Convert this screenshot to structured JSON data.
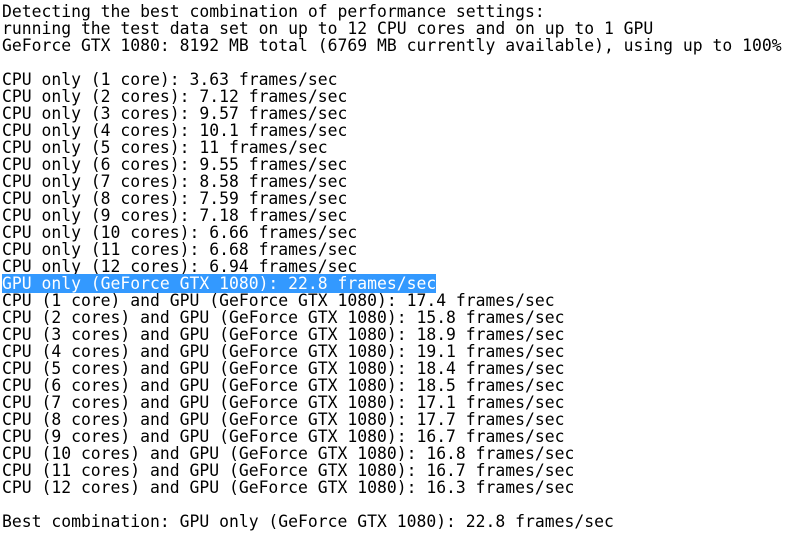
{
  "console": {
    "selection_color": "#3399ff",
    "lines": [
      {
        "text": "Detecting the best combination of performance settings:"
      },
      {
        "text": "running the test data set on up to 12 CPU cores and on up to 1 GPU"
      },
      {
        "text": "GeForce GTX 1080: 8192 MB total (6769 MB currently available), using up to 100%"
      },
      {
        "text": ""
      },
      {
        "text": "CPU only (1 core): 3.63 frames/sec"
      },
      {
        "text": "CPU only (2 cores): 7.12 frames/sec"
      },
      {
        "text": "CPU only (3 cores): 9.57 frames/sec"
      },
      {
        "text": "CPU only (4 cores): 10.1 frames/sec"
      },
      {
        "text": "CPU only (5 cores): 11 frames/sec"
      },
      {
        "text": "CPU only (6 cores): 9.55 frames/sec"
      },
      {
        "text": "CPU only (7 cores): 8.58 frames/sec"
      },
      {
        "text": "CPU only (8 cores): 7.59 frames/sec"
      },
      {
        "text": "CPU only (9 cores): 7.18 frames/sec"
      },
      {
        "text": "CPU only (10 cores): 6.66 frames/sec"
      },
      {
        "text": "CPU only (11 cores): 6.68 frames/sec"
      },
      {
        "text": "CPU only (12 cores): 6.94 frames/sec"
      },
      {
        "text": "GPU only (GeForce GTX 1080): 22.8 frames/sec",
        "selected": true
      },
      {
        "text": "CPU (1 core) and GPU (GeForce GTX 1080): 17.4 frames/sec"
      },
      {
        "text": "CPU (2 cores) and GPU (GeForce GTX 1080): 15.8 frames/sec"
      },
      {
        "text": "CPU (3 cores) and GPU (GeForce GTX 1080): 18.9 frames/sec"
      },
      {
        "text": "CPU (4 cores) and GPU (GeForce GTX 1080): 19.1 frames/sec"
      },
      {
        "text": "CPU (5 cores) and GPU (GeForce GTX 1080): 18.4 frames/sec"
      },
      {
        "text": "CPU (6 cores) and GPU (GeForce GTX 1080): 18.5 frames/sec"
      },
      {
        "text": "CPU (7 cores) and GPU (GeForce GTX 1080): 17.1 frames/sec"
      },
      {
        "text": "CPU (8 cores) and GPU (GeForce GTX 1080): 17.7 frames/sec"
      },
      {
        "text": "CPU (9 cores) and GPU (GeForce GTX 1080): 16.7 frames/sec"
      },
      {
        "text": "CPU (10 cores) and GPU (GeForce GTX 1080): 16.8 frames/sec"
      },
      {
        "text": "CPU (11 cores) and GPU (GeForce GTX 1080): 16.7 frames/sec"
      },
      {
        "text": "CPU (12 cores) and GPU (GeForce GTX 1080): 16.3 frames/sec"
      },
      {
        "text": ""
      },
      {
        "text": "Best combination: GPU only (GeForce GTX 1080): 22.8 frames/sec"
      }
    ]
  }
}
